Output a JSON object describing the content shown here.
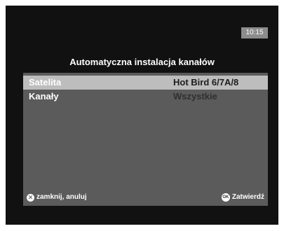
{
  "clock": "10:15",
  "title": "Automatyczna instalacja kanałów",
  "menu": [
    {
      "label": "Satelita",
      "value": "Hot Bird 6/7A/8"
    },
    {
      "label": "Kanały",
      "value": "Wszystkie"
    }
  ],
  "footer": {
    "cancel_label": "zamknij, anuluj",
    "ok_badge": "OK",
    "confirm_label": "Zatwierdź"
  },
  "colors": {
    "background": "#111111",
    "panel": "#5b5b5b",
    "selected_row": "#bdbdbd",
    "clock_badge": "#8c8c8c"
  },
  "icons": {
    "cancel": "close-circle-icon",
    "confirm": "ok-circle-icon"
  }
}
